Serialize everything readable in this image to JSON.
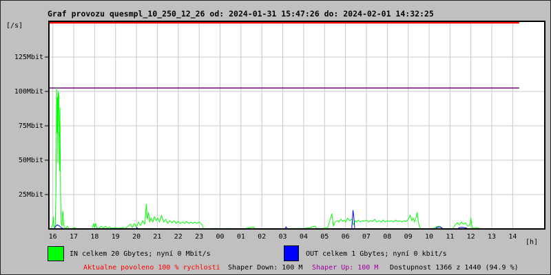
{
  "title": "Graf provozu quesmpl_10_250_12_26 od: 2024-01-31 15:47:26 do: 2024-02-01 14:32:25",
  "legend": {
    "in_label": "IN celkem 20 Gbytes; nyní 0 Mbit/s",
    "in_color": "#00ff00",
    "out_label": "OUT celkem 1 Gbytes; nyní 0 kbit/s",
    "out_color": "#0000ff"
  },
  "status": {
    "allowed": "Aktualne povoleno 100 % rychlosti",
    "allowed_color": "#ff0000",
    "shaper_down": "Shaper Down: 100 M",
    "shaper_up": "Shaper Up: 100 M",
    "shaper_up_color": "#a000a0",
    "availability": "Dostupnost 1366 z 1440 (94.9 %)"
  },
  "chart_data": {
    "type": "line",
    "title": "Graf provozu quesmpl_10_250_12_26",
    "time_from": "2024-01-31 15:47:26",
    "time_to": "2024-02-01 14:32:25",
    "y_unit": "[/s]",
    "x_unit": "[h]",
    "ylim": [
      0,
      150
    ],
    "grid": true,
    "y_ticks": [
      {
        "label": "25Mbit",
        "mbit": 25
      },
      {
        "label": "50Mbit",
        "mbit": 50
      },
      {
        "label": "75Mbit",
        "mbit": 75
      },
      {
        "label": "100Mbit",
        "mbit": 100
      },
      {
        "label": "125Mbit",
        "mbit": 125
      }
    ],
    "x_ticks": [
      {
        "label": "16",
        "h": 16
      },
      {
        "label": "17",
        "h": 17
      },
      {
        "label": "18",
        "h": 18
      },
      {
        "label": "19",
        "h": 19
      },
      {
        "label": "20",
        "h": 20
      },
      {
        "label": "21",
        "h": 21
      },
      {
        "label": "22",
        "h": 22
      },
      {
        "label": "23",
        "h": 23
      },
      {
        "label": "00",
        "h": 24
      },
      {
        "label": "01",
        "h": 25
      },
      {
        "label": "02",
        "h": 26
      },
      {
        "label": "03",
        "h": 27
      },
      {
        "label": "04",
        "h": 28
      },
      {
        "label": "05",
        "h": 29
      },
      {
        "label": "06",
        "h": 30
      },
      {
        "label": "07",
        "h": 31
      },
      {
        "label": "08",
        "h": 32
      },
      {
        "label": "09",
        "h": 33
      },
      {
        "label": "10",
        "h": 34
      },
      {
        "label": "11",
        "h": 35
      },
      {
        "label": "12",
        "h": 36
      },
      {
        "label": "13",
        "h": 37
      },
      {
        "label": "14",
        "h": 38
      }
    ],
    "series": [
      {
        "name": "IN",
        "color": "#00ff00",
        "width": 1,
        "points": [
          [
            15.81,
            0
          ],
          [
            15.9,
            0.3
          ],
          [
            15.95,
            2
          ],
          [
            16.0,
            4
          ],
          [
            16.03,
            9
          ],
          [
            16.05,
            2
          ],
          [
            16.08,
            1
          ],
          [
            16.12,
            3
          ],
          [
            16.15,
            30
          ],
          [
            16.18,
            103
          ],
          [
            16.2,
            70
          ],
          [
            16.22,
            96
          ],
          [
            16.24,
            48
          ],
          [
            16.26,
            100
          ],
          [
            16.29,
            97
          ],
          [
            16.32,
            42
          ],
          [
            16.34,
            88
          ],
          [
            16.37,
            25
          ],
          [
            16.4,
            4
          ],
          [
            16.44,
            2
          ],
          [
            16.48,
            13
          ],
          [
            16.52,
            3
          ],
          [
            16.56,
            1
          ],
          [
            16.62,
            0.3
          ],
          [
            16.7,
            2
          ],
          [
            16.76,
            0.3
          ],
          [
            16.9,
            0.2
          ],
          [
            17.05,
            1
          ],
          [
            17.12,
            0.2
          ],
          [
            17.5,
            0.1
          ],
          [
            17.9,
            0.3
          ],
          [
            17.95,
            4
          ],
          [
            18.0,
            1
          ],
          [
            18.05,
            4
          ],
          [
            18.1,
            0.8
          ],
          [
            18.2,
            0.4
          ],
          [
            18.32,
            2
          ],
          [
            18.42,
            0.8
          ],
          [
            18.52,
            2
          ],
          [
            18.6,
            0.4
          ],
          [
            18.72,
            1.5
          ],
          [
            18.82,
            0.4
          ],
          [
            19.0,
            1
          ],
          [
            19.1,
            0.3
          ],
          [
            19.35,
            1
          ],
          [
            19.45,
            0.2
          ],
          [
            19.72,
            3.5
          ],
          [
            19.8,
            1
          ],
          [
            19.9,
            4
          ],
          [
            20.0,
            1.5
          ],
          [
            20.1,
            5
          ],
          [
            20.2,
            2.5
          ],
          [
            20.3,
            6
          ],
          [
            20.4,
            3.5
          ],
          [
            20.47,
            18
          ],
          [
            20.52,
            7
          ],
          [
            20.58,
            12
          ],
          [
            20.63,
            5
          ],
          [
            20.7,
            8
          ],
          [
            20.78,
            5
          ],
          [
            20.86,
            9
          ],
          [
            20.94,
            6
          ],
          [
            21.02,
            8
          ],
          [
            21.1,
            5
          ],
          [
            21.2,
            10
          ],
          [
            21.3,
            5
          ],
          [
            21.4,
            7
          ],
          [
            21.5,
            4
          ],
          [
            21.6,
            6
          ],
          [
            21.7,
            4.5
          ],
          [
            21.8,
            6
          ],
          [
            21.9,
            4
          ],
          [
            22.0,
            5.5
          ],
          [
            22.1,
            4
          ],
          [
            22.2,
            5
          ],
          [
            22.3,
            4
          ],
          [
            22.4,
            5.5
          ],
          [
            22.5,
            4
          ],
          [
            22.6,
            5
          ],
          [
            22.7,
            4
          ],
          [
            22.8,
            5
          ],
          [
            22.9,
            4
          ],
          [
            23.0,
            5
          ],
          [
            23.08,
            4
          ],
          [
            23.14,
            3
          ],
          [
            23.2,
            0.4
          ],
          [
            23.5,
            0.2
          ],
          [
            23.8,
            0.4
          ],
          [
            24.1,
            0.2
          ],
          [
            24.4,
            0.4
          ],
          [
            24.8,
            0.2
          ],
          [
            25.2,
            0.3
          ],
          [
            25.6,
            1.5
          ],
          [
            25.68,
            0.3
          ],
          [
            26.0,
            0.2
          ],
          [
            26.5,
            0.3
          ],
          [
            27.0,
            0.2
          ],
          [
            27.5,
            0.4
          ],
          [
            28.0,
            0.3
          ],
          [
            28.3,
            1
          ],
          [
            28.55,
            2
          ],
          [
            28.62,
            0.4
          ],
          [
            28.9,
            0.3
          ],
          [
            29.15,
            1
          ],
          [
            29.35,
            11
          ],
          [
            29.42,
            2
          ],
          [
            29.5,
            5
          ],
          [
            29.6,
            6
          ],
          [
            29.68,
            5
          ],
          [
            29.78,
            7
          ],
          [
            29.86,
            5.5
          ],
          [
            29.94,
            6.5
          ],
          [
            30.02,
            5
          ],
          [
            30.1,
            8
          ],
          [
            30.2,
            6
          ],
          [
            30.3,
            7
          ],
          [
            30.38,
            3
          ],
          [
            30.46,
            6
          ],
          [
            30.54,
            5
          ],
          [
            30.62,
            6.5
          ],
          [
            30.7,
            5
          ],
          [
            30.8,
            6
          ],
          [
            30.9,
            5.5
          ],
          [
            31.0,
            6.5
          ],
          [
            31.1,
            5
          ],
          [
            31.2,
            6
          ],
          [
            31.3,
            5.5
          ],
          [
            31.4,
            7
          ],
          [
            31.5,
            5
          ],
          [
            31.6,
            6
          ],
          [
            31.7,
            5
          ],
          [
            31.8,
            6.5
          ],
          [
            31.9,
            5
          ],
          [
            32.0,
            6
          ],
          [
            32.1,
            5.5
          ],
          [
            32.2,
            6
          ],
          [
            32.3,
            5
          ],
          [
            32.4,
            6.5
          ],
          [
            32.5,
            5.5
          ],
          [
            32.6,
            6
          ],
          [
            32.7,
            5
          ],
          [
            32.8,
            6
          ],
          [
            32.9,
            5.5
          ],
          [
            33.0,
            7
          ],
          [
            33.1,
            10
          ],
          [
            33.17,
            6
          ],
          [
            33.24,
            8
          ],
          [
            33.3,
            5
          ],
          [
            33.37,
            8
          ],
          [
            33.43,
            12
          ],
          [
            33.48,
            6
          ],
          [
            33.53,
            2
          ],
          [
            33.58,
            0.3
          ],
          [
            33.9,
            0.2
          ],
          [
            34.2,
            0.4
          ],
          [
            34.35,
            1.5
          ],
          [
            34.45,
            2
          ],
          [
            34.55,
            1.5
          ],
          [
            34.62,
            0.3
          ],
          [
            34.9,
            0.2
          ],
          [
            35.15,
            0.4
          ],
          [
            35.25,
            3
          ],
          [
            35.35,
            4.5
          ],
          [
            35.45,
            3
          ],
          [
            35.55,
            5
          ],
          [
            35.65,
            3.5
          ],
          [
            35.75,
            4.5
          ],
          [
            35.85,
            2
          ],
          [
            35.95,
            3
          ],
          [
            36.0,
            8
          ],
          [
            36.06,
            1
          ],
          [
            36.15,
            0.5
          ],
          [
            36.3,
            1
          ],
          [
            36.4,
            0.3
          ],
          [
            36.7,
            0.1
          ],
          [
            37.2,
            0.1
          ],
          [
            37.8,
            0.1
          ],
          [
            38.31,
            0
          ]
        ]
      },
      {
        "name": "OUT",
        "color": "#0000ff",
        "width": 1,
        "points": [
          [
            15.81,
            0
          ],
          [
            16.08,
            0.3
          ],
          [
            16.14,
            2
          ],
          [
            16.2,
            3
          ],
          [
            16.28,
            2.5
          ],
          [
            16.36,
            1.5
          ],
          [
            16.45,
            0.5
          ],
          [
            16.55,
            0.2
          ],
          [
            16.7,
            0
          ],
          [
            19.98,
            0
          ],
          [
            20.02,
            1
          ],
          [
            20.08,
            0
          ],
          [
            27.1,
            0
          ],
          [
            27.16,
            1.5
          ],
          [
            27.22,
            0
          ],
          [
            30.3,
            0
          ],
          [
            30.36,
            13.5
          ],
          [
            30.4,
            9
          ],
          [
            30.44,
            0.5
          ],
          [
            30.5,
            0
          ],
          [
            34.3,
            0
          ],
          [
            34.38,
            1.2
          ],
          [
            34.5,
            1.5
          ],
          [
            34.6,
            1
          ],
          [
            34.66,
            0
          ],
          [
            35.35,
            0
          ],
          [
            35.45,
            1
          ],
          [
            35.6,
            1.2
          ],
          [
            35.75,
            0.8
          ],
          [
            35.88,
            0
          ],
          [
            38.31,
            0
          ]
        ]
      },
      {
        "name": "allowed_speed_100pct",
        "color": "#ff0000",
        "width": 2.5,
        "points": [
          [
            15.81,
            150
          ],
          [
            38.31,
            150
          ]
        ]
      },
      {
        "name": "shaper_limit_100M",
        "color": "#7f007f",
        "width": 1.4,
        "points": [
          [
            15.81,
            102.5
          ],
          [
            38.31,
            102.5
          ]
        ]
      }
    ]
  }
}
